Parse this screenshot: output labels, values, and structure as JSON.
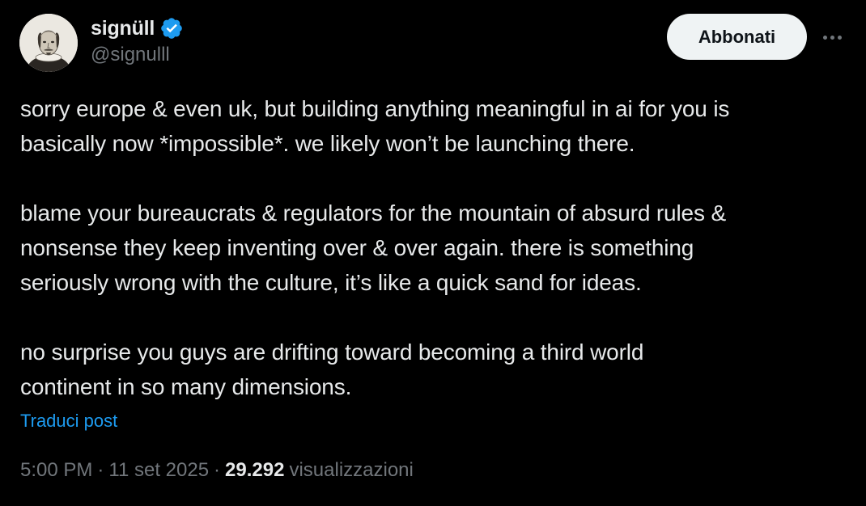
{
  "author": {
    "display_name": "signüll",
    "handle": "@signulll",
    "verified": true,
    "avatar_icon": "portrait-avatar"
  },
  "actions": {
    "follow_label": "Abbonati",
    "more_icon": "more-horizontal-icon"
  },
  "tweet": {
    "paragraphs": [
      [
        "sorry europe & even uk, but building anything meaningful in ai for you is",
        "basically now *impossible*. we likely won’t be launching there."
      ],
      [
        "blame your bureaucrats & regulators for the mountain of absurd rules &",
        "nonsense they keep inventing over & over again. there is something",
        "seriously wrong with the culture, it’s like a quick sand for ideas."
      ],
      [
        "no surprise you guys are drifting toward becoming a third world",
        "continent in so many dimensions."
      ]
    ],
    "translate_label": "Traduci post"
  },
  "meta": {
    "time": "5:00 PM",
    "separator": "·",
    "date": "11 set 2025",
    "views_count": "29.292",
    "views_label": "visualizzazioni"
  },
  "colors": {
    "background": "#000000",
    "text_primary": "#e7e9ea",
    "text_secondary": "#71767b",
    "accent_blue": "#1d9bf0",
    "verified_blue": "#1d9bf0",
    "button_bg": "#eff3f4"
  }
}
